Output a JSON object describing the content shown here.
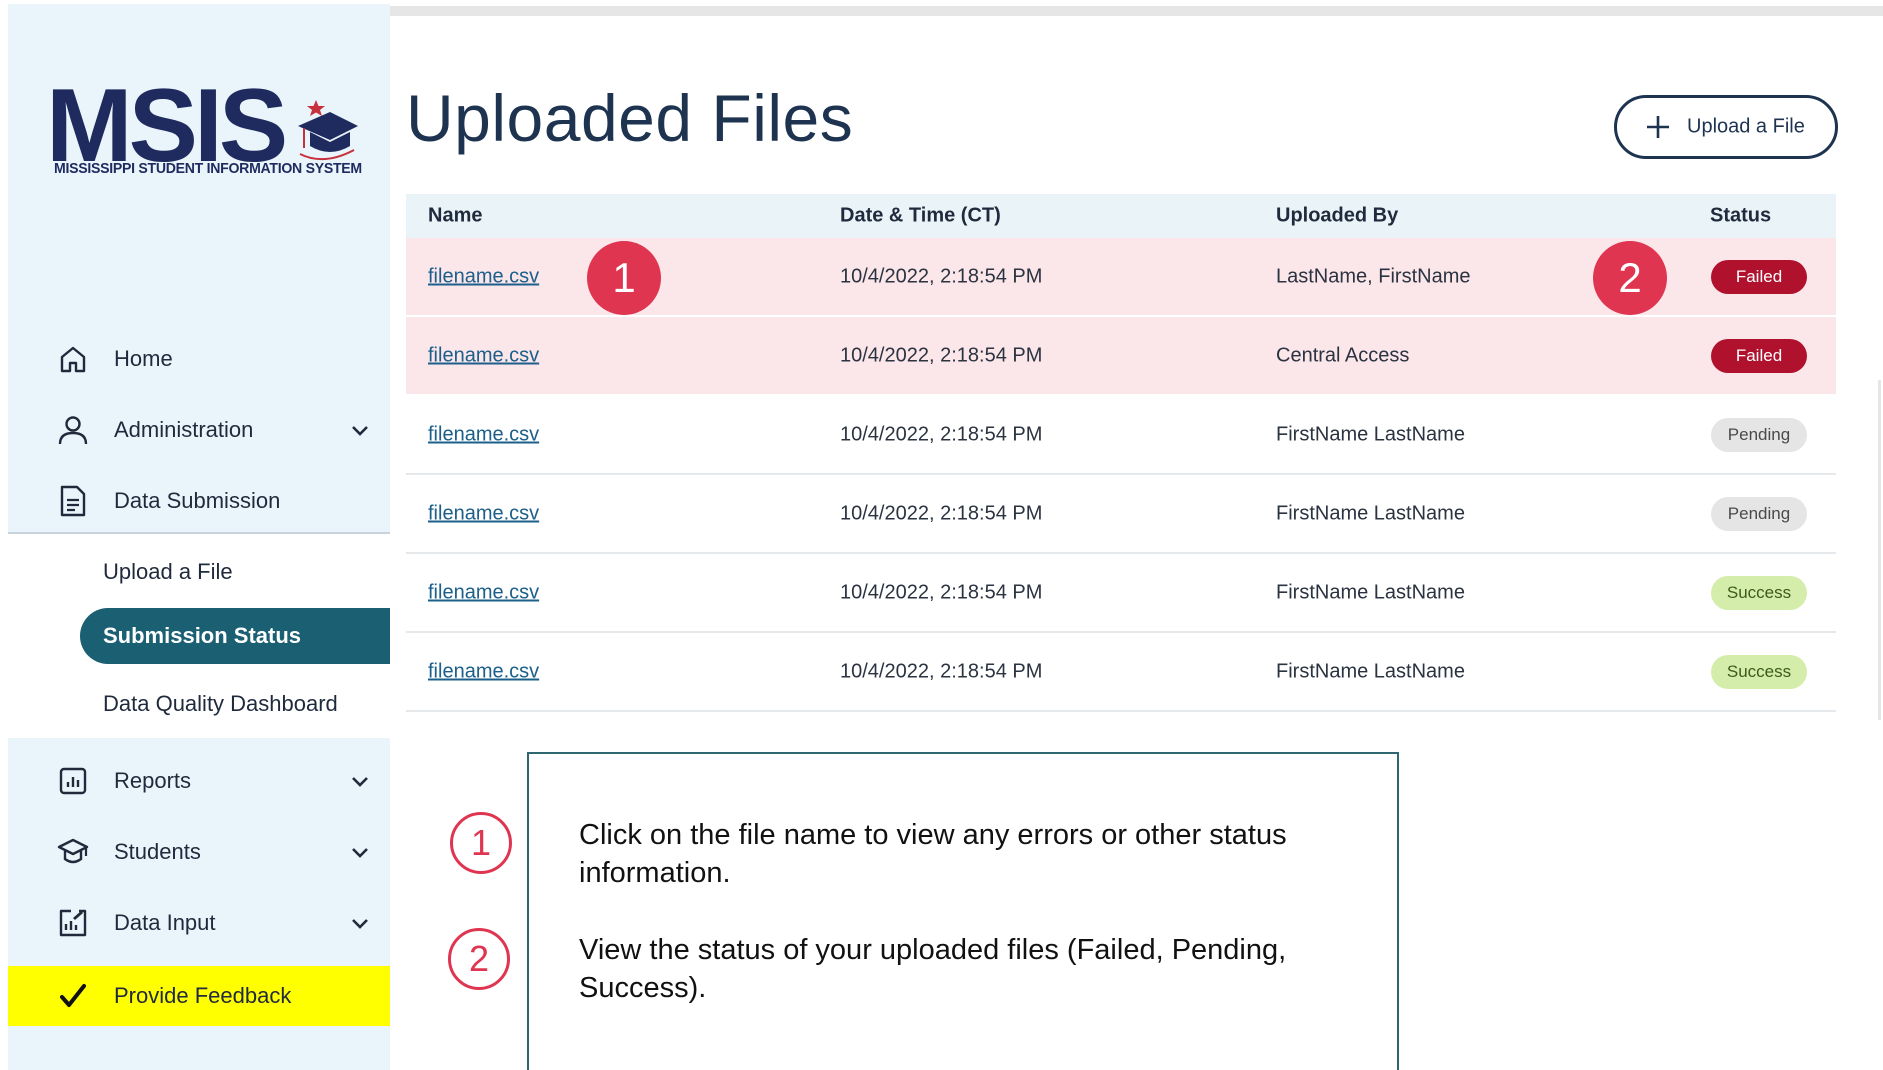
{
  "logo": {
    "wordmark": "MSIS",
    "subtitle": "MISSISSIPPI STUDENT INFORMATION SYSTEM"
  },
  "sidebar": {
    "items": [
      {
        "label": "Home",
        "icon": "home-icon",
        "has_chevron": false
      },
      {
        "label": "Administration",
        "icon": "user-icon",
        "has_chevron": true
      },
      {
        "label": "Data Submission",
        "icon": "document-icon",
        "has_chevron": false
      }
    ],
    "submenu": [
      {
        "label": "Upload a File",
        "active": false
      },
      {
        "label": "Submission Status",
        "active": true
      },
      {
        "label": "Data Quality Dashboard",
        "active": false
      }
    ],
    "items_lower": [
      {
        "label": "Reports",
        "icon": "bar-chart-icon",
        "has_chevron": true
      },
      {
        "label": "Students",
        "icon": "graduation-cap-icon",
        "has_chevron": true
      },
      {
        "label": "Data Input",
        "icon": "data-input-icon",
        "has_chevron": true
      }
    ],
    "feedback": {
      "label": "Provide Feedback",
      "icon": "checkmark-icon",
      "background": "#ffff00"
    }
  },
  "main": {
    "title": "Uploaded Files",
    "upload_button": "Upload a File",
    "table": {
      "headers": [
        "Name",
        "Date & Time (CT)",
        "Uploaded By",
        "Status"
      ],
      "rows": [
        {
          "name": "filename.csv",
          "datetime": "10/4/2022, 2:18:54 PM",
          "uploaded_by": "LastName, FirstName",
          "status": "Failed"
        },
        {
          "name": "filename.csv",
          "datetime": "10/4/2022, 2:18:54 PM",
          "uploaded_by": "Central Access",
          "status": "Failed"
        },
        {
          "name": "filename.csv",
          "datetime": "10/4/2022, 2:18:54 PM",
          "uploaded_by": "FirstName LastName",
          "status": "Pending"
        },
        {
          "name": "filename.csv",
          "datetime": "10/4/2022, 2:18:54 PM",
          "uploaded_by": "FirstName LastName",
          "status": "Pending"
        },
        {
          "name": "filename.csv",
          "datetime": "10/4/2022, 2:18:54 PM",
          "uploaded_by": "FirstName LastName",
          "status": "Success"
        },
        {
          "name": "filename.csv",
          "datetime": "10/4/2022, 2:18:54 PM",
          "uploaded_by": "FirstName LastName",
          "status": "Success"
        }
      ]
    },
    "markers": [
      "1",
      "2"
    ]
  },
  "callout": {
    "items": [
      {
        "number": "1",
        "text": "Click on the file name to view any errors or other status information."
      },
      {
        "number": "2",
        "text": "View the status of your uploaded files (Failed, Pending, Success)."
      }
    ]
  },
  "colors": {
    "brand_navy": "#1e3350",
    "active_teal": "#1b5f73",
    "failed_red": "#b0122e",
    "failed_row": "#fbe6ea",
    "marker_red": "#e03551",
    "pending_gray": "#e5e5e5",
    "success_green": "#d4edaa",
    "sidebar_bg": "#eaf4fb"
  }
}
